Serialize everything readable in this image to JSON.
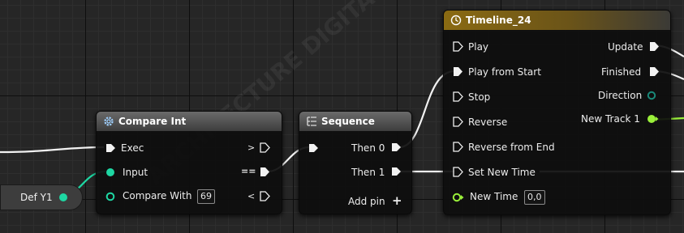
{
  "colors": {
    "exec": "#ffffff",
    "integer": "#1ed7a3",
    "float": "#9af03a",
    "timeline_header": "#8a6a12"
  },
  "var_node": {
    "label": "Def Y1"
  },
  "compare_node": {
    "title": "Compare Int",
    "icon": "cog-icon",
    "pins": {
      "exec": "Exec",
      "input": "Input",
      "compare_with": "Compare With",
      "compare_with_value": "69",
      "greater": ">",
      "equal": "==",
      "less": "<"
    }
  },
  "sequence_node": {
    "title": "Sequence",
    "icon": "sequence-icon",
    "pins": {
      "then0": "Then 0",
      "then1": "Then 1",
      "add_pin": "Add pin"
    }
  },
  "timeline_node": {
    "title": "Timeline_24",
    "icon": "clock-icon",
    "inputs": [
      "Play",
      "Play from Start",
      "Stop",
      "Reverse",
      "Reverse from End",
      "Set New Time"
    ],
    "new_time_label": "New Time",
    "new_time_value": "0,0",
    "outputs": {
      "update": "Update",
      "finished": "Finished",
      "direction": "Direction",
      "new_track": "New Track 1"
    }
  },
  "watermark": {
    "text": "ARCHITECTURE DIGITALE"
  }
}
